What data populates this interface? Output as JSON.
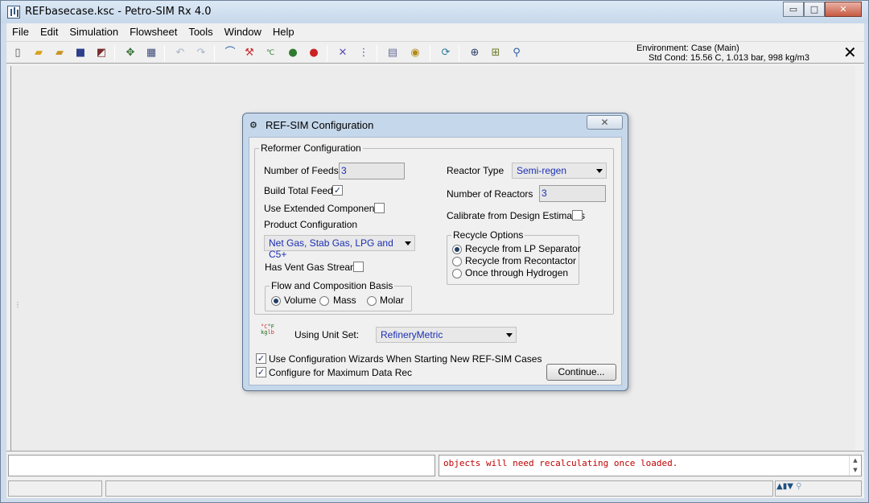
{
  "window": {
    "title": "REFbasecase.ksc - Petro-SIM Rx 4.0"
  },
  "window_buttons": {
    "minimize": "▭",
    "maximize": "□",
    "close": "✕"
  },
  "menu": [
    "File",
    "Edit",
    "Simulation",
    "Flowsheet",
    "Tools",
    "Window",
    "Help"
  ],
  "toolbar": {
    "environment": "Environment: Case (Main)",
    "std_cond": "Std Cond: 15.56 C, 1.013 bar, 998 kg/m3",
    "close_glyph": "✕"
  },
  "dialog": {
    "title": "REF-SIM Configuration",
    "close_glyph": "✕",
    "reformer_group": "Reformer Configuration",
    "number_of_feeds_label": "Number of Feeds",
    "number_of_feeds_value": "3",
    "build_total_feed_label": "Build Total Feed",
    "build_total_feed_checked": "✓",
    "use_extended_label": "Use Extended Components",
    "product_config_label": "Product Configuration",
    "product_config_value": "Net Gas, Stab Gas, LPG and C5+",
    "has_vent_label": "Has Vent Gas Stream",
    "flow_basis_group": "Flow and Composition Basis",
    "basis_options": [
      "Volume",
      "Mass",
      "Molar"
    ],
    "reactor_type_label": "Reactor Type",
    "reactor_type_value": "Semi-regen",
    "number_of_reactors_label": "Number of Reactors",
    "number_of_reactors_value": "3",
    "calibrate_label": "Calibrate from Design Estimates",
    "recycle_group": "Recycle Options",
    "recycle_options": [
      "Recycle from LP Separator",
      "Recycle from Recontactor",
      "Once through Hydrogen"
    ],
    "unit_set_label": "Using Unit Set:",
    "unit_set_value": "RefineryMetric",
    "use_wizards_label": "Use Configuration Wizards When Starting New REF-SIM Cases",
    "use_wizards_checked": "✓",
    "max_data_rec_label": "Configure for Maximum Data Rec",
    "max_data_rec_checked": "✓",
    "continue_label": "Continue..."
  },
  "trace": {
    "message": "objects will need recalculating once loaded."
  }
}
